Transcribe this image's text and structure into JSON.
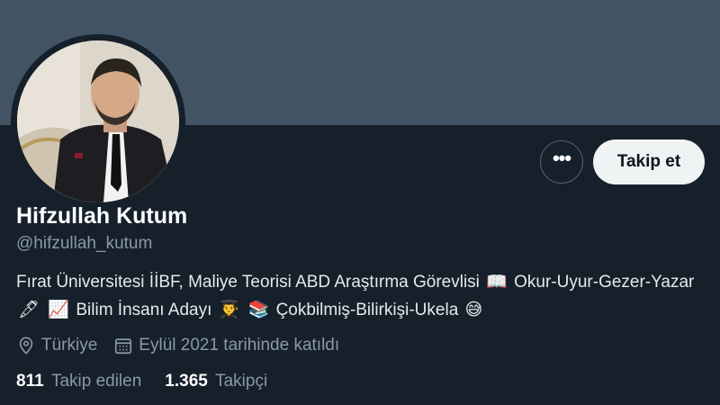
{
  "profile": {
    "name": "Hifzullah Kutum",
    "handle": "@hifzullah_kutum",
    "bio": {
      "part1": "Fırat Üniversitesi İİBF, Maliye Teorisi ABD Araştırma Görevlisi",
      "emoji_book": "📖",
      "part2": "Okur-Uyur-Gezer-Yazar",
      "emoji_pen": "🖋",
      "emoji_chart": "📈",
      "part3": "Bilim İnsanı Adayı",
      "emoji_grad": "👨‍🎓",
      "emoji_books": "📚",
      "part4": "Çokbilmiş-Bilirkişi-Ukela",
      "emoji_smile": "😅"
    },
    "location": "Türkiye",
    "joined": "Eylül 2021 tarihinde katıldı",
    "following_count": "811",
    "following_label": "Takip edilen",
    "followers_count": "1.365",
    "followers_label": "Takipçi"
  },
  "actions": {
    "more_label": "•••",
    "follow_label": "Takip et"
  },
  "icons": {
    "location": "location-pin-icon",
    "calendar": "calendar-icon",
    "more": "more-options-icon"
  },
  "colors": {
    "background": "#15202b",
    "banner": "#425364",
    "secondary_text": "#8b98a5",
    "follow_button_bg": "#eff3f4"
  }
}
